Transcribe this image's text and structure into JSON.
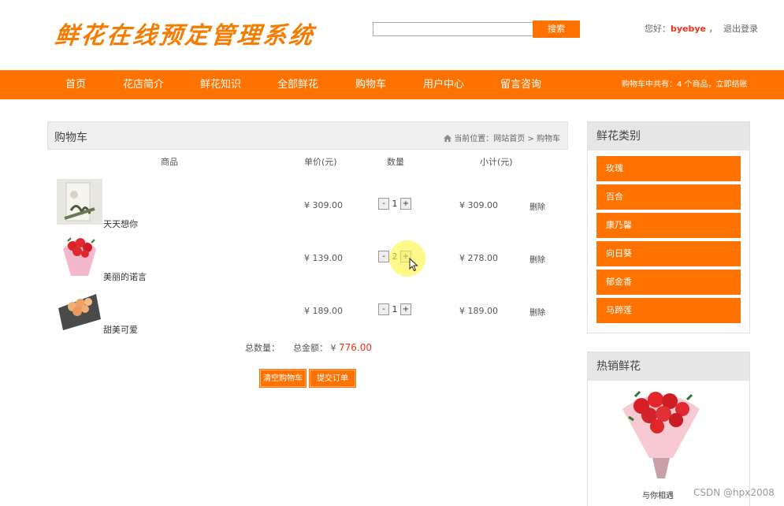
{
  "header": {
    "logo_text": "鲜花在线预定管理系统",
    "search_placeholder": "",
    "search_button": "搜索",
    "greeting": "您好：",
    "username": "byebye",
    "separator": "，",
    "logout": "退出登录"
  },
  "nav": {
    "items": [
      "首页",
      "花店简介",
      "鲜花知识",
      "全部鲜花",
      "购物车",
      "用户中心",
      "留言咨询"
    ],
    "cart_info": "购物车中共有：4 个商品，立即结账"
  },
  "cart": {
    "title": "购物车",
    "breadcrumb": "当前位置：网站首页 > 购物车",
    "columns": [
      "商品",
      "单价(元)",
      "数量",
      "小计(元)"
    ],
    "rows": [
      {
        "name": "天天想你",
        "price": "¥ 309.00",
        "qty": "1",
        "subtotal": "¥ 309.00",
        "delete": "删除"
      },
      {
        "name": "美丽的诺言",
        "price": "¥ 139.00",
        "qty": "2",
        "subtotal": "¥ 278.00",
        "delete": "删除"
      },
      {
        "name": "甜美可爱",
        "price": "¥ 189.00",
        "qty": "1",
        "subtotal": "¥ 189.00",
        "delete": "删除"
      }
    ],
    "qty_minus": "-",
    "qty_plus": "+",
    "total_count_label": "总数量：",
    "total_amount_label": "总金额：",
    "currency": "¥",
    "total_amount": "776.00",
    "clear_button": "清空购物车",
    "submit_button": "提交订单"
  },
  "sidebar": {
    "categories_title": "鲜花类别",
    "categories": [
      "玫瑰",
      "百合",
      "康乃馨",
      "向日葵",
      "郁金香",
      "马蹄莲"
    ],
    "hot_title": "热销鲜花",
    "hot_item_name": "与你相遇"
  },
  "watermark": "CSDN @hpx2008",
  "colors": {
    "accent": "#ff7200",
    "price_red": "#e8361a",
    "header_gray": "#efefef"
  }
}
